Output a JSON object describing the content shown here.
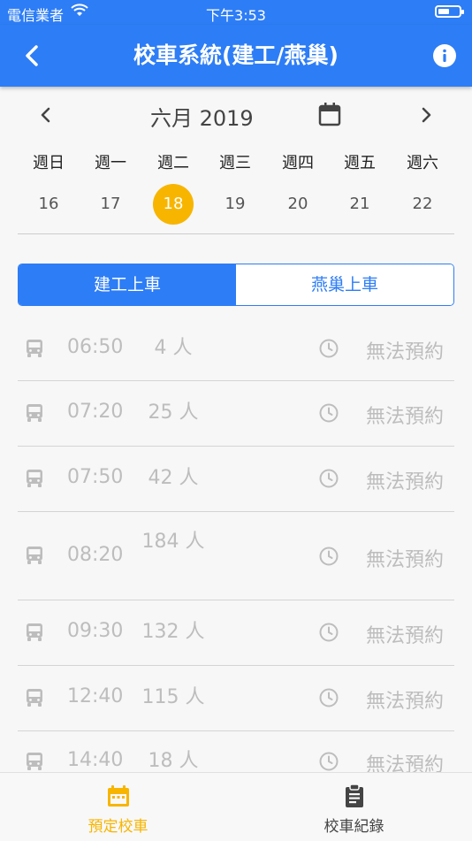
{
  "status_bar": {
    "carrier": "電信業者",
    "time": "下午3:53"
  },
  "nav": {
    "title": "校車系統(建工/燕巢)"
  },
  "calendar": {
    "month_label": "六月 2019",
    "weekdays": [
      "週日",
      "週一",
      "週二",
      "週三",
      "週四",
      "週五",
      "週六"
    ],
    "days": [
      "16",
      "17",
      "18",
      "19",
      "20",
      "21",
      "22"
    ],
    "selected_day": "18"
  },
  "segment": {
    "options": [
      "建工上車",
      "燕巢上車"
    ],
    "selected": "建工上車"
  },
  "schedule": [
    {
      "time": "06:50",
      "count": "4 人",
      "status": "無法預約"
    },
    {
      "time": "07:20",
      "count": "25 人",
      "status": "無法預約"
    },
    {
      "time": "07:50",
      "count": "42 人",
      "status": "無法預約"
    },
    {
      "time": "08:20",
      "count": "184 人",
      "status": "無法預約"
    },
    {
      "time": "09:30",
      "count": "132 人",
      "status": "無法預約"
    },
    {
      "time": "12:40",
      "count": "115 人",
      "status": "無法預約"
    },
    {
      "time": "14:40",
      "count": "18 人",
      "status": "無法預約"
    }
  ],
  "tabs": [
    {
      "label": "預定校車",
      "icon": "calendar-icon",
      "active": true
    },
    {
      "label": "校車紀錄",
      "icon": "clipboard-icon",
      "active": false
    }
  ],
  "colors": {
    "primary": "#2d7df6",
    "accent": "#f7b500",
    "muted": "#bdbdbd"
  }
}
